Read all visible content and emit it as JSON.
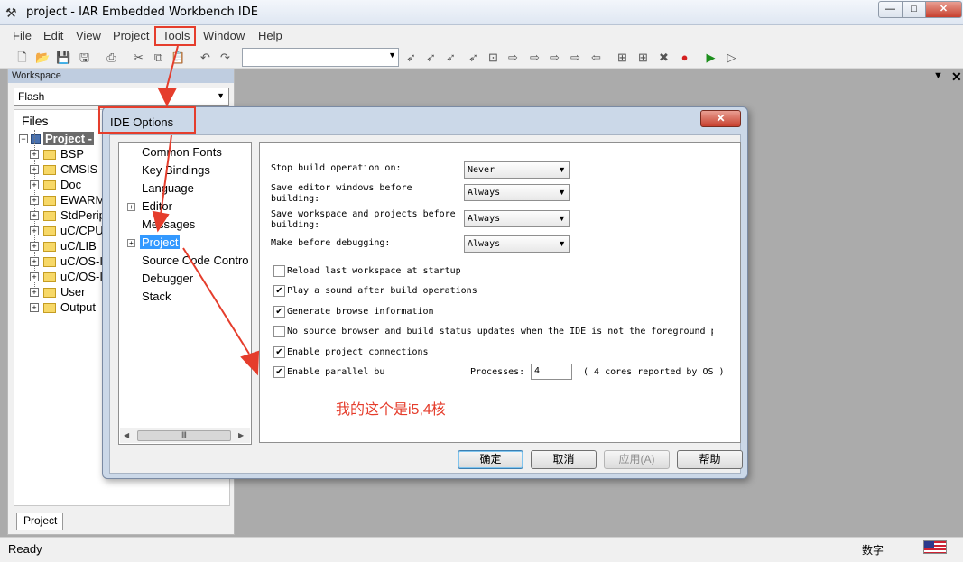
{
  "window": {
    "title": "project - IAR Embedded Workbench IDE",
    "min_glyph": "—",
    "max_glyph": "□",
    "close_glyph": "✕"
  },
  "menu": [
    "File",
    "Edit",
    "View",
    "Project",
    "Tools",
    "Window",
    "Help"
  ],
  "workspace": {
    "header": "Workspace",
    "config": "Flash",
    "files_label": "Files",
    "root": "Project -",
    "items": [
      "BSP",
      "CMSIS",
      "Doc",
      "EWARM",
      "StdPerip",
      "uC/CPU",
      "uC/LIB",
      "uC/OS-II",
      "uC/OS-II",
      "User",
      "Output"
    ],
    "tab": "Project"
  },
  "status": {
    "text": "Ready",
    "ime": "数字"
  },
  "dialog": {
    "title": "IDE Options",
    "categories": [
      {
        "label": "Common Fonts",
        "expandable": false
      },
      {
        "label": "Key Bindings",
        "expandable": false
      },
      {
        "label": "Language",
        "expandable": false
      },
      {
        "label": "Editor",
        "expandable": true
      },
      {
        "label": "Messages",
        "expandable": false
      },
      {
        "label": "Project",
        "expandable": true,
        "selected": true
      },
      {
        "label": "Source Code Contro",
        "expandable": false
      },
      {
        "label": "Debugger",
        "expandable": false
      },
      {
        "label": "Stack",
        "expandable": false
      }
    ],
    "settings": [
      {
        "label": "Stop build operation on:",
        "value": "Never"
      },
      {
        "label": "Save editor windows before building:",
        "value": "Always"
      },
      {
        "label": "Save workspace and projects before building:",
        "value": "Always"
      },
      {
        "label": "Make before debugging:",
        "value": "Always"
      }
    ],
    "checkboxes": [
      {
        "label": "Reload last workspace at startup",
        "checked": false
      },
      {
        "label": "Play a sound after build operations",
        "checked": true
      },
      {
        "label": "Generate browse information",
        "checked": true
      },
      {
        "label": "No source browser and build status updates when the IDE is not the foreground p",
        "checked": false
      },
      {
        "label": "Enable project connections",
        "checked": true
      },
      {
        "label": "Enable parallel bu",
        "checked": true
      }
    ],
    "processes_label": "Processes:",
    "processes_value": "4",
    "cores_note": "( 4 cores reported by OS )",
    "annotation": "我的这个是i5,4核",
    "buttons": {
      "ok": "确定",
      "cancel": "取消",
      "apply": "应用(A)",
      "help": "帮助"
    }
  },
  "colors": {
    "highlight_red": "#e53d2c",
    "selection_blue": "#3399ff"
  }
}
